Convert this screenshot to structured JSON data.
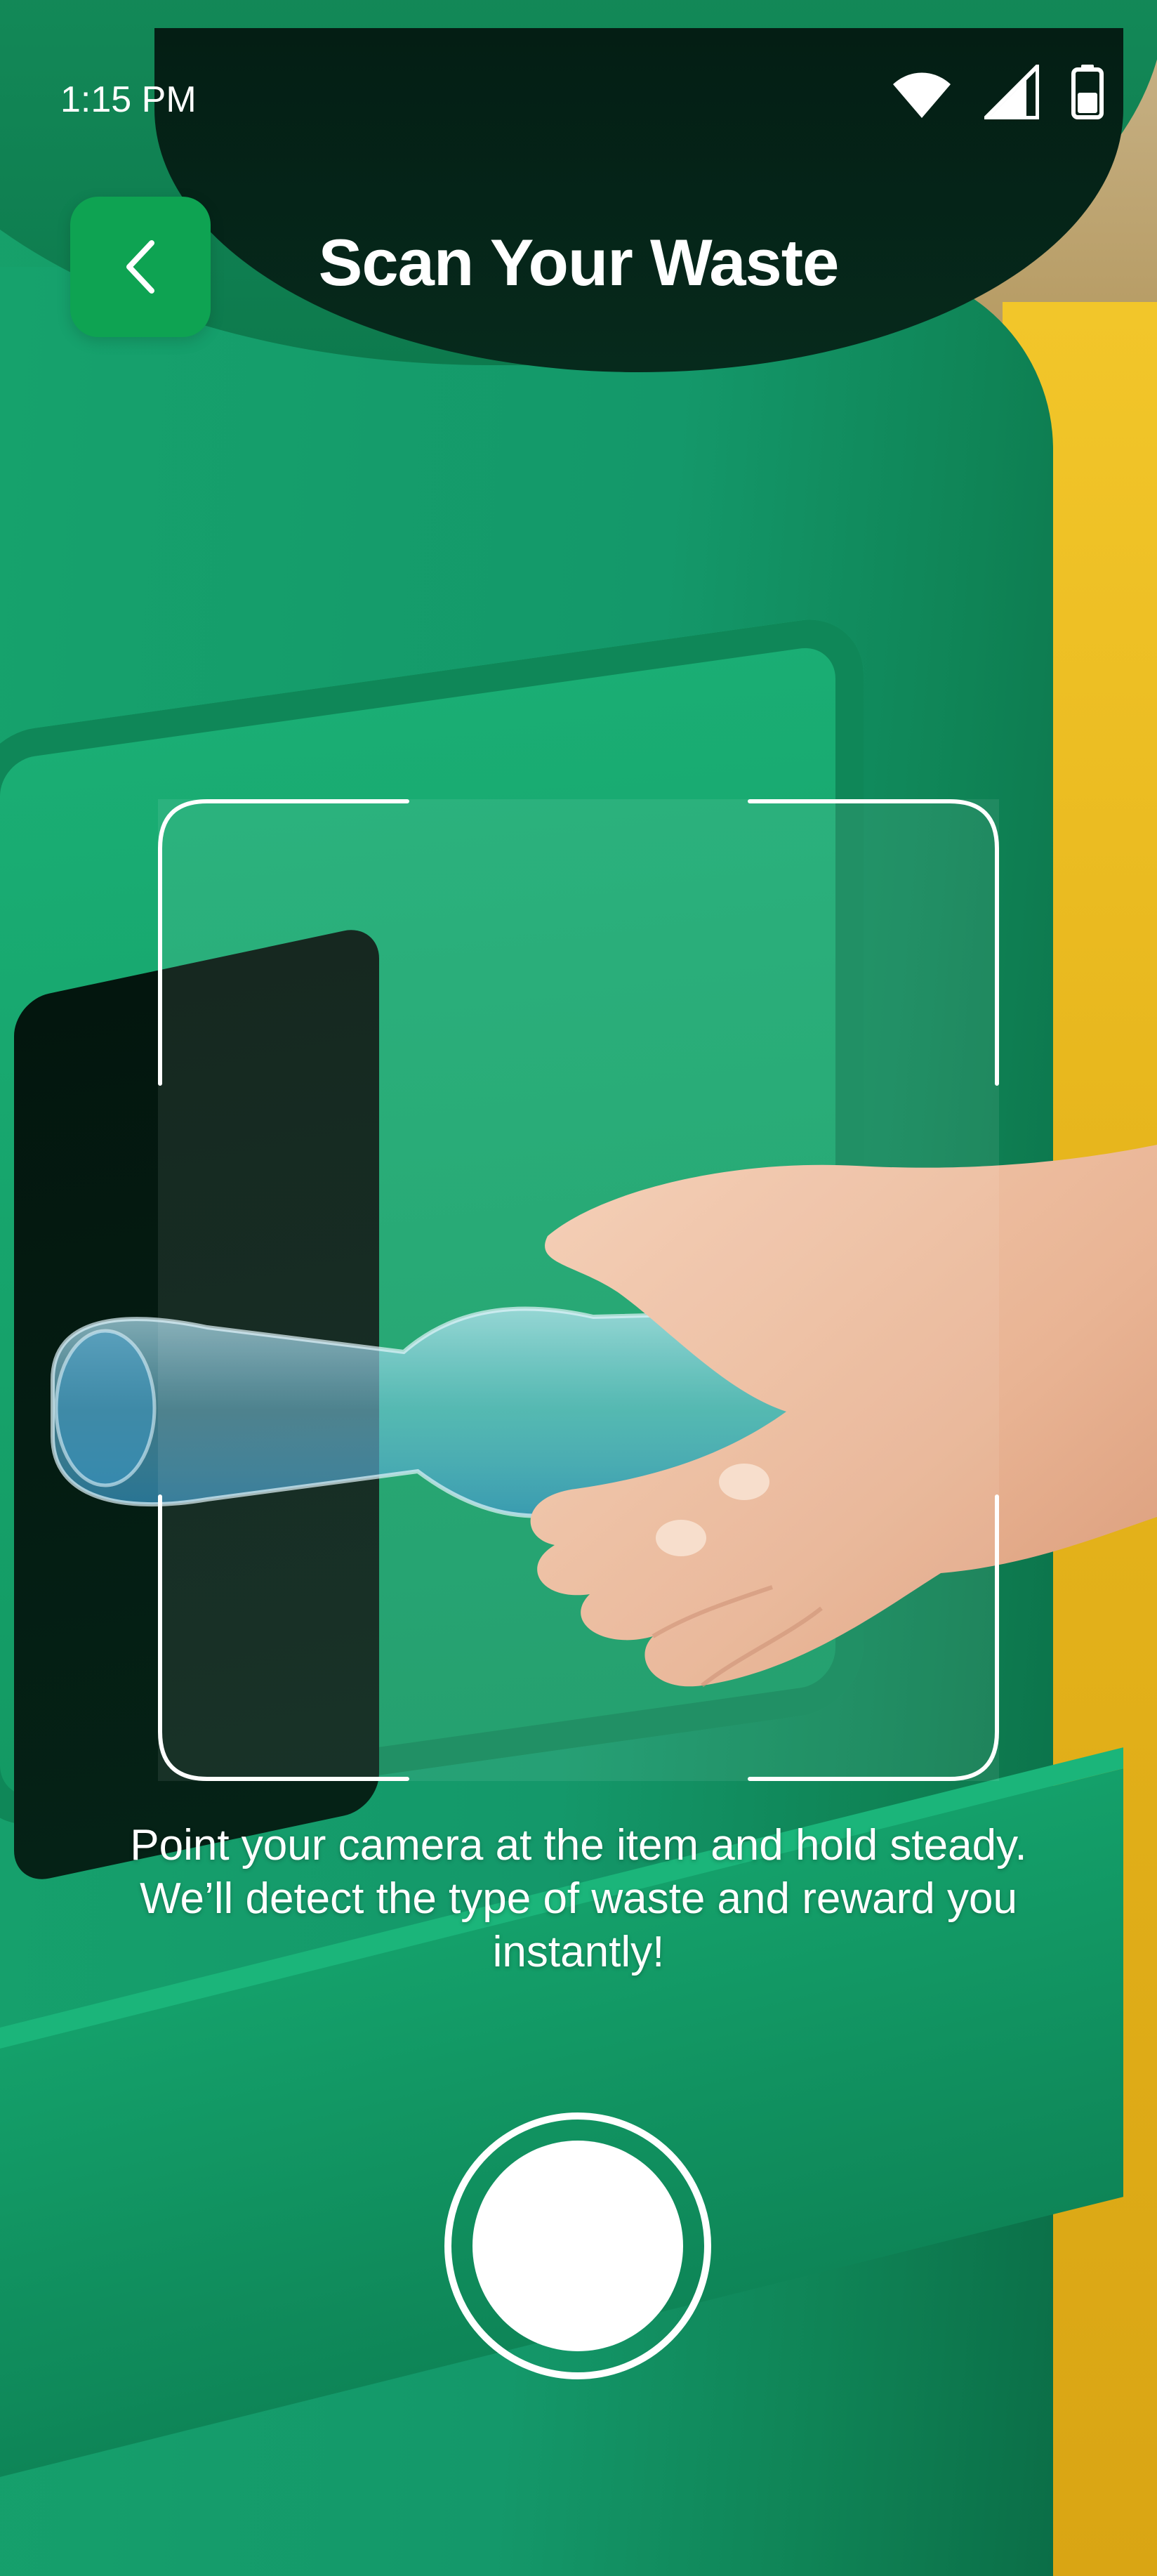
{
  "status_bar": {
    "time": "1:15 PM",
    "icons": [
      "wifi-icon",
      "cellular-signal-icon",
      "battery-icon"
    ]
  },
  "header": {
    "title": "Scan Your Waste",
    "back_icon": "chevron-left-icon"
  },
  "scanner": {
    "instruction": "Point your camera at the item and hold steady. We’ll detect the type of waste and reward you instantly!"
  },
  "camera": {
    "shutter_icon": "shutter-button-icon"
  },
  "colors": {
    "accent": "#0ea352",
    "bin_green": "#14986a",
    "bin_yellow": "#e6b51c",
    "bottle_cap": "#1e90d8"
  }
}
